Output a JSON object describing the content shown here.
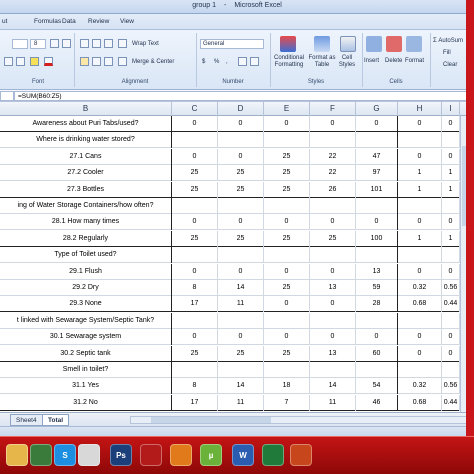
{
  "window": {
    "title_left": "group 1",
    "title_sep": "-",
    "title_app": "Microsoft Excel"
  },
  "tabs": [
    "ut",
    "Formulas",
    "Data",
    "Review",
    "View"
  ],
  "ribbon": {
    "font_size": "8",
    "wrap_text": "Wrap Text",
    "merge_center": "Merge & Center",
    "number_format": "General",
    "currency": "$",
    "percent": "%",
    "comma": ",",
    "conditional_formatting": "Conditional Formatting",
    "format_as_table": "Format as Table",
    "cell_styles": "Cell Styles",
    "insert": "Insert",
    "delete": "Delete",
    "format": "Format",
    "autosum": "Σ AutoSum",
    "fill": "Fill",
    "clear": "Clear",
    "groups": {
      "font": "Font",
      "alignment": "Alignment",
      "number": "Number",
      "styles": "Styles",
      "cells": "Cells"
    }
  },
  "formula_bar": {
    "fx": "=SUM(B60:Z5)"
  },
  "columns": [
    "B",
    "C",
    "D",
    "E",
    "F",
    "G",
    "H",
    "I"
  ],
  "rows": [
    {
      "label": "Awareness about Puri Tabs/used?",
      "values": [
        "0",
        "0",
        "0",
        "0",
        "0",
        "0",
        "0"
      ],
      "thick": true
    },
    {
      "label": "Where is drinking water stored?",
      "values": [
        "",
        "",
        "",
        "",
        "",
        "",
        ""
      ],
      "thick": false
    },
    {
      "label": "27.1 Cans",
      "values": [
        "0",
        "0",
        "25",
        "22",
        "47",
        "0",
        "0"
      ],
      "thick": false
    },
    {
      "label": "27.2 Cooler",
      "values": [
        "25",
        "25",
        "25",
        "22",
        "97",
        "1",
        "1"
      ],
      "thick": false
    },
    {
      "label": "27.3 Bottles",
      "values": [
        "25",
        "25",
        "25",
        "26",
        "101",
        "1",
        "1"
      ],
      "thick": true
    },
    {
      "label": "ing of Water Storage Containers/how often?",
      "values": [
        "",
        "",
        "",
        "",
        "",
        "",
        ""
      ],
      "thick": false
    },
    {
      "label": "28.1 How many times",
      "values": [
        "0",
        "0",
        "0",
        "0",
        "0",
        "0",
        "0"
      ],
      "thick": false
    },
    {
      "label": "28.2 Regularly",
      "values": [
        "25",
        "25",
        "25",
        "25",
        "100",
        "1",
        "1"
      ],
      "thick": true
    },
    {
      "label": "Type of Toilet used?",
      "values": [
        "",
        "",
        "",
        "",
        "",
        "",
        ""
      ],
      "thick": false
    },
    {
      "label": "29.1 Flush",
      "values": [
        "0",
        "0",
        "0",
        "0",
        "13",
        "0",
        "0"
      ],
      "thick": false
    },
    {
      "label": "29.2 Dry",
      "values": [
        "8",
        "14",
        "25",
        "13",
        "59",
        "0.32",
        "0.56"
      ],
      "thick": false
    },
    {
      "label": "29.3 None",
      "values": [
        "17",
        "11",
        "0",
        "0",
        "28",
        "0.68",
        "0.44"
      ],
      "thick": true
    },
    {
      "label": "t linked with Sewarage System/Septic Tank?",
      "values": [
        "",
        "",
        "",
        "",
        "",
        "",
        ""
      ],
      "thick": false
    },
    {
      "label": "30.1 Sewarage system",
      "values": [
        "0",
        "0",
        "0",
        "0",
        "0",
        "0",
        "0"
      ],
      "thick": false
    },
    {
      "label": "30.2 Septic tank",
      "values": [
        "25",
        "25",
        "25",
        "13",
        "60",
        "0",
        "0"
      ],
      "thick": true
    },
    {
      "label": "Smell in toilet?",
      "values": [
        "",
        "",
        "",
        "",
        "",
        "",
        ""
      ],
      "thick": false
    },
    {
      "label": "31.1 Yes",
      "values": [
        "8",
        "14",
        "18",
        "14",
        "54",
        "0.32",
        "0.56"
      ],
      "thick": false
    },
    {
      "label": "31.2 No",
      "values": [
        "17",
        "11",
        "7",
        "11",
        "46",
        "0.68",
        "0.44"
      ],
      "thick": true
    }
  ],
  "sheets": [
    "Sheet4",
    "Total"
  ],
  "active_sheet": "Total",
  "taskbar": {
    "icons": [
      "folder-icon",
      "media-icon",
      "skype-icon",
      "chrome-icon",
      "photoshop-icon",
      "acrobat-icon",
      "app-icon",
      "utorrent-icon",
      "word-icon",
      "excel-icon",
      "powerpoint-icon"
    ],
    "labels": [
      "",
      "",
      "S",
      "",
      "Ps",
      "",
      "",
      "µ",
      "W",
      "",
      ""
    ]
  },
  "colors": {
    "accent": "#c8161b",
    "ribbon": "#dfe9f6"
  }
}
